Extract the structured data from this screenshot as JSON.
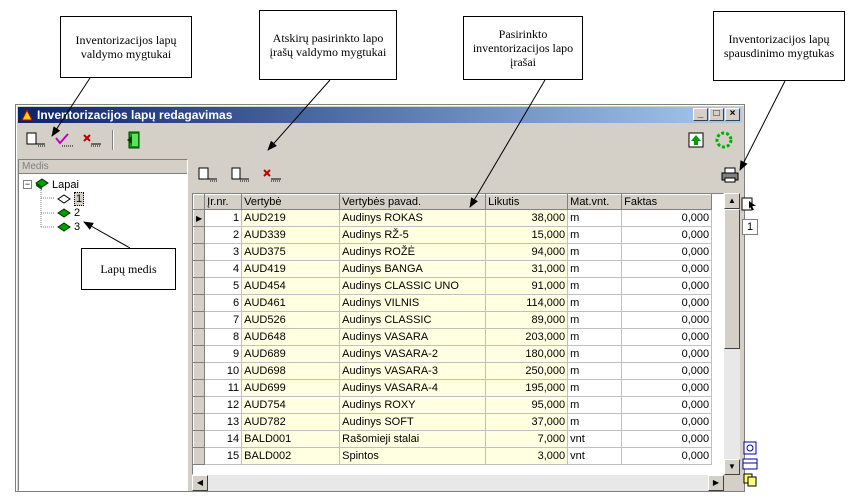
{
  "callouts": {
    "c1": "Inventorizacijos lapų valdymo mygtukai",
    "c2": "Atskirų pasirinkto lapo įrašų valdymo mygtukai",
    "c3": "Pasirinkto inventorizacijos lapo įrašai",
    "c4": "Inventorizacijos lapų spausdinimo mygtukas",
    "c5": "Lapų medis"
  },
  "window": {
    "title": "Inventorizacijos lapų redagavimas",
    "min": "_",
    "max": "□",
    "close": "×"
  },
  "tree": {
    "header": "Medis",
    "root": "Lapai",
    "items": [
      "1",
      "2",
      "3"
    ]
  },
  "table": {
    "columns": [
      "Įr.nr.",
      "Vertybė",
      "Vertybės pavad.",
      "Likutis",
      "Mat.vnt.",
      "Faktas"
    ],
    "rows": [
      [
        "1",
        "AUD219",
        "Audinys ROKAS",
        "38,000",
        "m",
        "0,000"
      ],
      [
        "2",
        "AUD339",
        "Audinys RŽ-5",
        "15,000",
        "m",
        "0,000"
      ],
      [
        "3",
        "AUD375",
        "Audinys ROŽĖ",
        "94,000",
        "m",
        "0,000"
      ],
      [
        "4",
        "AUD419",
        "Audinys BANGA",
        "31,000",
        "m",
        "0,000"
      ],
      [
        "5",
        "AUD454",
        "Audinys CLASSIC UNO",
        "91,000",
        "m",
        "0,000"
      ],
      [
        "6",
        "AUD461",
        "Audinys VILNIS",
        "114,000",
        "m",
        "0,000"
      ],
      [
        "7",
        "AUD526",
        "Audinys CLASSIC",
        "89,000",
        "m",
        "0,000"
      ],
      [
        "8",
        "AUD648",
        "Audinys VASARA",
        "203,000",
        "m",
        "0,000"
      ],
      [
        "9",
        "AUD689",
        "Audinys VASARA-2",
        "180,000",
        "m",
        "0,000"
      ],
      [
        "10",
        "AUD698",
        "Audinys VASARA-3",
        "250,000",
        "m",
        "0,000"
      ],
      [
        "11",
        "AUD699",
        "Audinys VASARA-4",
        "195,000",
        "m",
        "0,000"
      ],
      [
        "12",
        "AUD754",
        "Audinys ROXY",
        "95,000",
        "m",
        "0,000"
      ],
      [
        "13",
        "AUD782",
        "Audinys SOFT",
        "37,000",
        "m",
        "0,000"
      ],
      [
        "14",
        "BALD001",
        "Rašomieji stalai",
        "7,000",
        "vnt",
        "0,000"
      ],
      [
        "15",
        "BALD002",
        "Spintos",
        "3,000",
        "vnt",
        "0,000"
      ]
    ]
  },
  "side": {
    "page": "1"
  }
}
